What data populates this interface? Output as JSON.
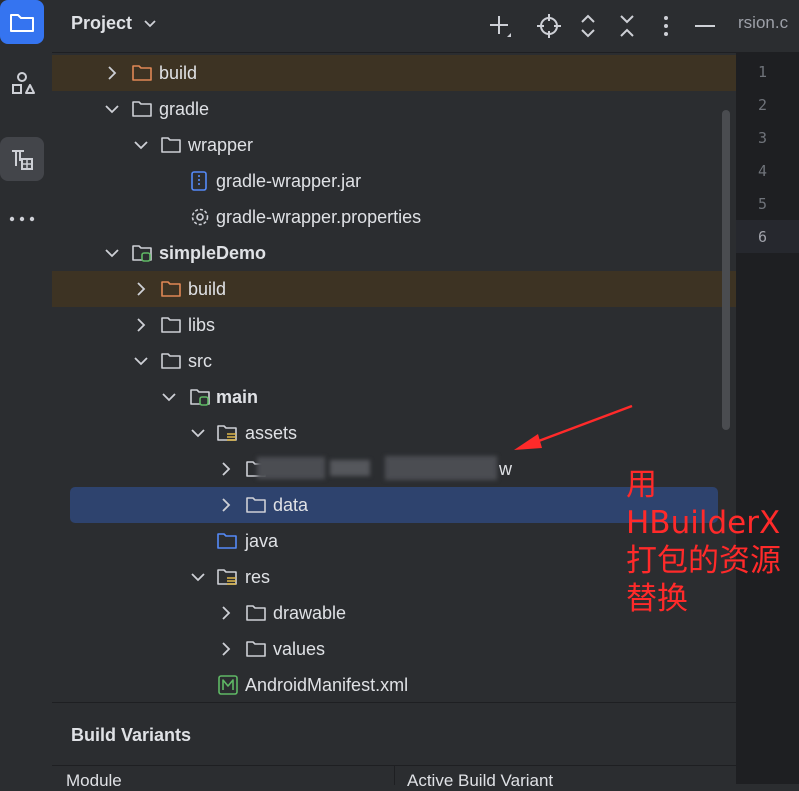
{
  "activity_bar": {
    "items": [
      "project-folder",
      "structure",
      "build-variants-tool",
      "more"
    ]
  },
  "project_panel": {
    "title": "Project",
    "toolbar": [
      "add-icon",
      "crosshair-icon",
      "expand-all-icon",
      "collapse-all-icon",
      "more-icon",
      "minimize-icon"
    ]
  },
  "tree": {
    "rows": [
      {
        "label": "build"
      },
      {
        "label": "gradle"
      },
      {
        "label": "wrapper"
      },
      {
        "label": "gradle-wrapper.jar"
      },
      {
        "label": "gradle-wrapper.properties"
      },
      {
        "label": "simpleDemo"
      },
      {
        "label": "build"
      },
      {
        "label": "libs"
      },
      {
        "label": "src"
      },
      {
        "label": "main"
      },
      {
        "label": "assets"
      },
      {
        "label": "w"
      },
      {
        "label": "data"
      },
      {
        "label": "java"
      },
      {
        "label": "res"
      },
      {
        "label": "drawable"
      },
      {
        "label": "values"
      },
      {
        "label": "AndroidManifest.xml"
      }
    ]
  },
  "editor": {
    "tab_fragment": "rsion.c",
    "line_numbers": [
      "1",
      "2",
      "3",
      "4",
      "5",
      "6"
    ]
  },
  "annotation": {
    "lines": [
      "用",
      "HBuilderX",
      "打包的资源",
      "替换"
    ],
    "color": "#ff2a2a"
  },
  "build_variants": {
    "title": "Build Variants",
    "columns": [
      "Module",
      "Active Build Variant"
    ]
  },
  "colors": {
    "panel_bg": "#2b2d30",
    "selection": "#2e436e",
    "excluded_row": "#3d3323",
    "accent": "#3574f0"
  }
}
